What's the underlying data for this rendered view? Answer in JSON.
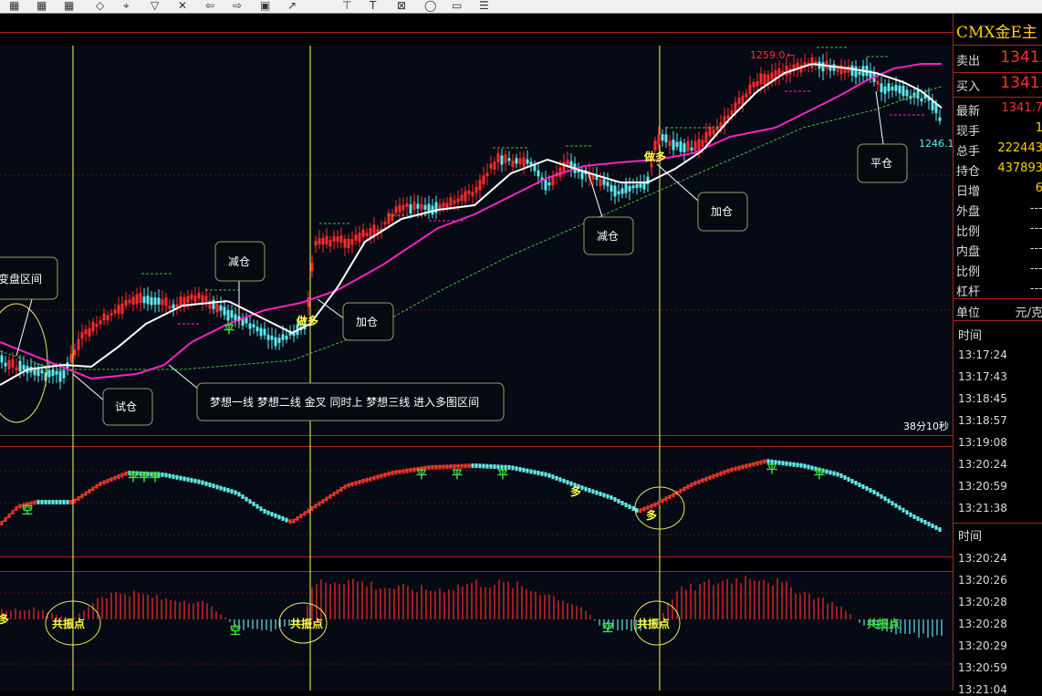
{
  "panel": {
    "title": "CMX金E主",
    "sell_label": "卖出",
    "sell_value": "1341.",
    "buy_label": "买入",
    "buy_value": "1341.",
    "rows": [
      {
        "label": "最新",
        "value": "1341.7",
        "color": "red"
      },
      {
        "label": "现手",
        "value": "1",
        "color": "yellow"
      },
      {
        "label": "总手",
        "value": "222443",
        "color": "yellow"
      },
      {
        "label": "持仓",
        "value": "437893",
        "color": "yellow"
      },
      {
        "label": "日增",
        "value": "6",
        "color": "yellow"
      },
      {
        "label": "外盘",
        "value": "---",
        "color": "white"
      },
      {
        "label": "比例",
        "value": "---",
        "color": "white"
      },
      {
        "label": "内盘",
        "value": "---",
        "color": "white"
      },
      {
        "label": "比例",
        "value": "---",
        "color": "white"
      },
      {
        "label": "杠杆",
        "value": "---",
        "color": "white"
      }
    ],
    "unit_label": "单位",
    "unit_value": "元/克",
    "time_header1": "时间",
    "times1": [
      "13:17:24",
      "13:17:43",
      "13:18:45",
      "13:18:57",
      "13:19:08",
      "13:20:24",
      "13:20:59",
      "13:21:38"
    ],
    "time_header2": "时间",
    "times2": [
      "13:20:24",
      "13:20:26",
      "13:20:28",
      "13:20:28",
      "13:20:29",
      "13:20:59",
      "13:21:04"
    ]
  },
  "chart": {
    "price_high_label": "1259.0",
    "price_low_label": "1246.1",
    "timer": "38分10秒",
    "annotations": {
      "transform_zone": "变盘区间",
      "trial_position": "试仓",
      "reduce1": "减仓",
      "add1": "加仓",
      "info": "梦想一线 梦想二线 金叉 同时上 梦想三线 进入多图区间",
      "reduce2": "减仓",
      "add2": "加仓",
      "close": "平仓"
    },
    "signals": {
      "buy_long": "做多",
      "flat": "平",
      "empty": "空",
      "long": "多",
      "resonance": "共振点",
      "flat3": "平平平"
    }
  },
  "colors": {
    "bull": "#ff2a2a",
    "bear": "#5fe8f0",
    "white_line": "#ffffff",
    "magenta_line": "#ff20c8",
    "green_dash": "#40c040",
    "grid_red": "#8a1818",
    "vline": "#ffff60"
  }
}
